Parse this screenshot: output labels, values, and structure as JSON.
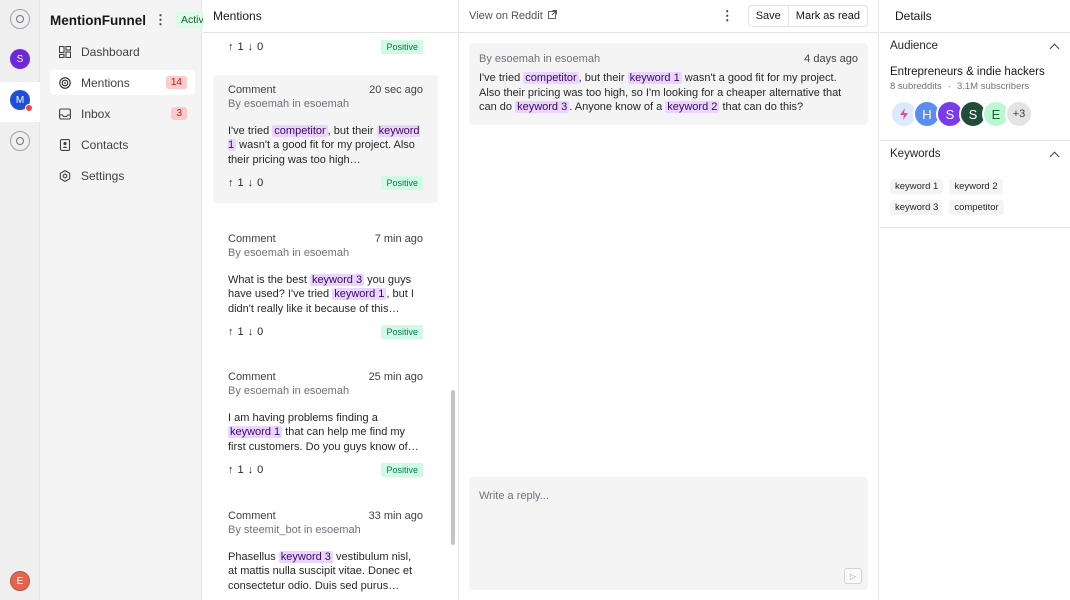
{
  "rail": {
    "workspaces": [
      {
        "initial": "S",
        "color": "#6d28d9"
      },
      {
        "initial": "M",
        "color": "#1d4ed8"
      }
    ],
    "user_initial": "E",
    "user_color": "#e0664e"
  },
  "sidebar": {
    "brand": "MentionFunnel",
    "status": "Active",
    "items": [
      {
        "label": "Dashboard",
        "icon": "dashboard-icon"
      },
      {
        "label": "Mentions",
        "icon": "target-icon",
        "count": "14"
      },
      {
        "label": "Inbox",
        "icon": "inbox-icon",
        "count": "3"
      },
      {
        "label": "Contacts",
        "icon": "contacts-icon"
      },
      {
        "label": "Settings",
        "icon": "gear-icon"
      }
    ]
  },
  "mentions": {
    "title": "Mentions",
    "partial_item": {
      "up": "1",
      "down": "0",
      "sentiment": "Positive"
    },
    "items": [
      {
        "type": "Comment",
        "time": "20 sec ago",
        "by": "By esoemah in esoemah",
        "body": [
          {
            "t": "I've tried "
          },
          {
            "k": "competitor"
          },
          {
            "t": ", but their "
          },
          {
            "k": "keyword 1"
          },
          {
            "t": " wasn't a good fit for my project. Also their pricing was too high…"
          }
        ],
        "up": "1",
        "down": "0",
        "sentiment": "Positive"
      },
      {
        "type": "Comment",
        "time": "7 min ago",
        "by": "By esoemah in esoemah",
        "body": [
          {
            "t": "What is the best "
          },
          {
            "k": "keyword 3"
          },
          {
            "t": " you guys have used? I've tried "
          },
          {
            "k": "keyword 1"
          },
          {
            "t": ", but I didn't really like it because of this…"
          }
        ],
        "up": "1",
        "down": "0",
        "sentiment": "Positive"
      },
      {
        "type": "Comment",
        "time": "25 min ago",
        "by": "By esoemah in esoemah",
        "body": [
          {
            "t": "I am having problems finding a "
          },
          {
            "k": "keyword 1"
          },
          {
            "t": " that can help me find my first customers. Do you guys know of…"
          }
        ],
        "up": "1",
        "down": "0",
        "sentiment": "Positive"
      },
      {
        "type": "Comment",
        "time": "33 min ago",
        "by": "By steemit_bot in esoemah",
        "body": [
          {
            "t": "Phasellus "
          },
          {
            "k": "keyword 3"
          },
          {
            "t": " vestibulum nisl, at mattis nulla suscipit vitae. Donec et consectetur odio. Duis sed purus…"
          }
        ]
      }
    ]
  },
  "main": {
    "view_link": "View on Reddit",
    "save": "Save",
    "mark_read": "Mark as read",
    "post": {
      "by": "By esoemah in esoemah",
      "time": "4 days ago",
      "body": [
        {
          "t": "I've tried "
        },
        {
          "k": "competitor"
        },
        {
          "t": ", but their "
        },
        {
          "k": "keyword 1"
        },
        {
          "t": " wasn't a good fit for my project. Also their pricing was too high, so I'm looking for a cheaper alternative that can do "
        },
        {
          "k": "keyword 3"
        },
        {
          "t": ". Anyone know of a "
        },
        {
          "k": "keyword 2"
        },
        {
          "t": " that can do this?"
        }
      ]
    },
    "reply_placeholder": "Write a reply..."
  },
  "details": {
    "title": "Details",
    "audience": {
      "heading": "Audience",
      "name": "Entrepreneurs & indie hackers",
      "subreddits": "8 subreddits",
      "subscribers": "3.1M subscribers",
      "avatars": [
        {
          "label": "",
          "color": "#dbeafe"
        },
        {
          "label": "H",
          "color": "#5b8def"
        },
        {
          "label": "S",
          "color": "#7c3aed"
        },
        {
          "label": "S",
          "color": "#1f4d3a"
        },
        {
          "label": "E",
          "color": "#bbf7d0"
        },
        {
          "label": "+3",
          "color": "#e4e4e7"
        }
      ]
    },
    "keywords": {
      "heading": "Keywords",
      "list": [
        "keyword 1",
        "keyword 2",
        "keyword 3",
        "competitor"
      ]
    }
  }
}
